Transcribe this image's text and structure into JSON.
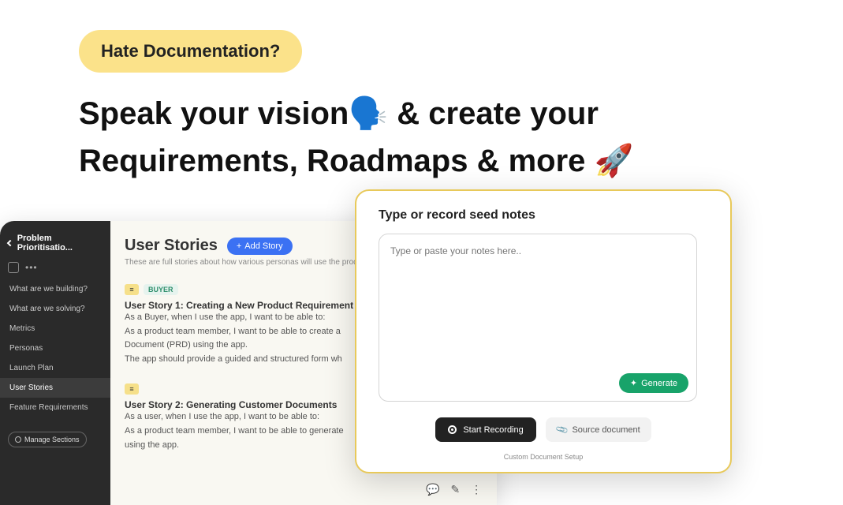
{
  "hero": {
    "pill": "Hate Documentation?",
    "line1": "Speak your vision🗣️ & create your",
    "line2": "Requirements, Roadmaps & more 🚀"
  },
  "sidebar": {
    "project_title": "Problem Prioritisatio...",
    "items": [
      {
        "label": "What are we building?",
        "active": false
      },
      {
        "label": "What are we solving?",
        "active": false
      },
      {
        "label": "Metrics",
        "active": false
      },
      {
        "label": "Personas",
        "active": false
      },
      {
        "label": "Launch Plan",
        "active": false
      },
      {
        "label": "User Stories",
        "active": true
      },
      {
        "label": "Feature Requirements",
        "active": false
      }
    ],
    "manage_label": "Manage Sections"
  },
  "content": {
    "title": "User Stories",
    "add_label": "Add Story",
    "subtitle": "These are full stories about how various personas will use the produc",
    "stories": [
      {
        "persona": "BUYER",
        "title": "User Story 1: Creating a New Product Requirement",
        "lines": [
          "As a Buyer, when I use the app, I want to be able to:",
          "As a product team member, I want to be able to create a",
          "Document (PRD) using the app.",
          "The app should provide a guided and structured form wh"
        ]
      },
      {
        "persona": "",
        "title": "User Story 2: Generating Customer Documents",
        "lines": [
          "As a user, when I use the app, I want to be able to:",
          "As a product team member, I want to be able to generate",
          "using the app."
        ]
      }
    ]
  },
  "modal": {
    "title": "Type or record seed notes",
    "placeholder": "Type or paste your notes here..",
    "generate": "Generate",
    "start_recording": "Start Recording",
    "source_doc": "Source document",
    "footer": "Custom Document Setup"
  }
}
